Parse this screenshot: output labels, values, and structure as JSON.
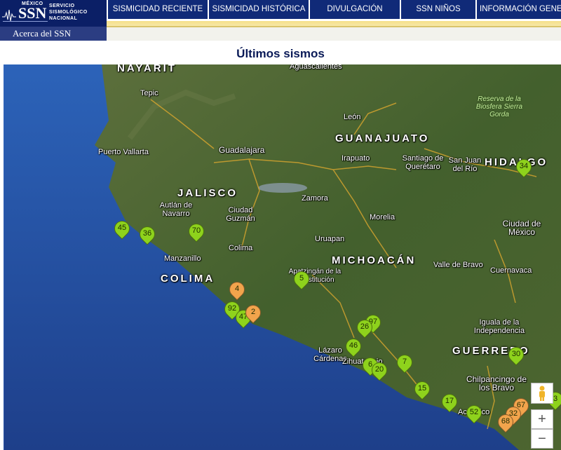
{
  "logo": {
    "mexico": "MÉXICO",
    "ssn": "SSN",
    "line1": "SERVICIO",
    "line2": "SISMOLÓGICO",
    "line3": "NACIONAL",
    "acerca": "Acerca del SSN"
  },
  "nav": [
    "SISMICIDAD RECIENTE",
    "SISMICIDAD HISTÓRICA",
    "DIVULGACIÓN",
    "SSN NIÑOS",
    "INFORMACIÓN GENER"
  ],
  "page_title": "Últimos sismos",
  "map": {
    "states": [
      "NAYARIT",
      "GUANAJUATO",
      "JALISCO",
      "HIDALGO",
      "MICHOACÁN",
      "COLIMA",
      "GUERRERO"
    ],
    "cities": [
      "Aguascalientes",
      "Tepic",
      "León",
      "Puerto Vallarta",
      "Guadalajara",
      "Irapuato",
      "Santiago de Querétaro",
      "San Juan del Río",
      "Zamora",
      "Autlán de Navarro",
      "Ciudad Guzmán",
      "Morelia",
      "Uruapan",
      "Colima",
      "Manzanillo",
      "Ciudad de México",
      "Apatzingán de la Constitución",
      "Valle de Bravo",
      "Cuernavaca",
      "Iguala de la Independencia",
      "Lázaro Cárdenas",
      "Zihuatanejo",
      "Chilpancingo de los Bravo",
      "Acapulco"
    ],
    "reserve": "Reserva de la Biosfera Sierra Gorda",
    "markers": [
      "34",
      "45",
      "36",
      "70",
      "4",
      "5",
      "92",
      "47",
      "2",
      "97",
      "26",
      "46",
      "6",
      "20",
      "7",
      "30",
      "15",
      "17",
      "52",
      "67",
      "32",
      "68",
      "3"
    ],
    "marker_colors": {
      "green": "#8ed21c",
      "orange": "#f2a44c"
    },
    "controls": {
      "zoom_in": "+",
      "zoom_out": "−"
    }
  }
}
